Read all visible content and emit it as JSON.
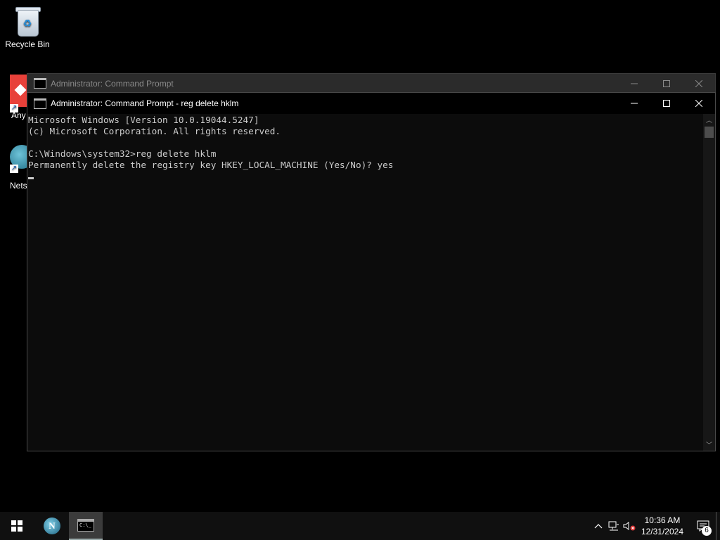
{
  "desktop": {
    "icons": [
      {
        "label": "Recycle Bin",
        "icon": "recycle-bin-icon"
      },
      {
        "label": "Any",
        "icon": "anydesk-icon"
      },
      {
        "label": "Nets",
        "icon": "netscape-icon"
      }
    ]
  },
  "back_window": {
    "title": "Administrator: Command Prompt",
    "icon": "command-prompt-icon"
  },
  "front_window": {
    "title": "Administrator: Command Prompt - reg  delete hklm",
    "icon": "command-prompt-icon",
    "console_lines": [
      "Microsoft Windows [Version 10.0.19044.5247]",
      "(c) Microsoft Corporation. All rights reserved.",
      "",
      "C:\\Windows\\system32>reg delete hklm",
      "Permanently delete the registry key HKEY_LOCAL_MACHINE (Yes/No)? yes"
    ]
  },
  "taskbar": {
    "apps": [
      {
        "name": "start",
        "icon": "windows-start-icon"
      },
      {
        "name": "netscape",
        "icon": "netscape-icon",
        "glyph": "N"
      },
      {
        "name": "command-prompt",
        "icon": "command-prompt-icon",
        "active": true,
        "glyph": "C:\\_"
      }
    ],
    "tray": {
      "time": "10:36 AM",
      "date": "12/31/2024",
      "notification_count": "6"
    }
  }
}
